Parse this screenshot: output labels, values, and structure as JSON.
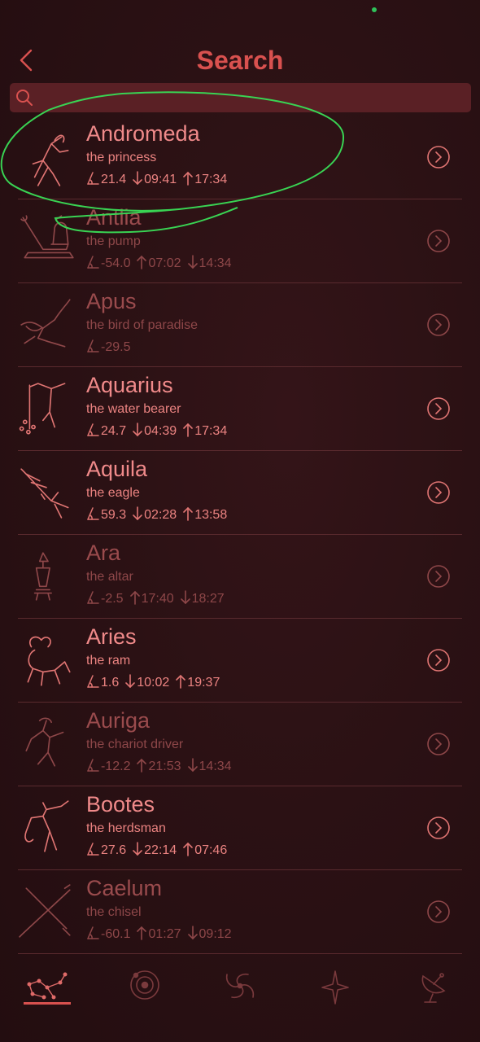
{
  "header": {
    "title": "Search"
  },
  "search": {
    "placeholder": "",
    "value": ""
  },
  "constellations": [
    {
      "name": "Andromeda",
      "subtitle": "the princess",
      "altitude": "21.4",
      "time1": "09:41",
      "dir1": "down",
      "time2": "17:34",
      "dir2": "up",
      "visible": true,
      "icon": "andromeda-figure-icon"
    },
    {
      "name": "Antlia",
      "subtitle": "the pump",
      "altitude": "-54.0",
      "time1": "07:02",
      "dir1": "up",
      "time2": "14:34",
      "dir2": "down",
      "visible": false,
      "icon": "antlia-pump-icon"
    },
    {
      "name": "Apus",
      "subtitle": "the bird of paradise",
      "altitude": "-29.5",
      "time1": "",
      "dir1": "",
      "time2": "",
      "dir2": "",
      "visible": false,
      "icon": "apus-bird-icon"
    },
    {
      "name": "Aquarius",
      "subtitle": "the water bearer",
      "altitude": "24.7",
      "time1": "04:39",
      "dir1": "down",
      "time2": "17:34",
      "dir2": "up",
      "visible": true,
      "icon": "aquarius-water-bearer-icon"
    },
    {
      "name": "Aquila",
      "subtitle": "the eagle",
      "altitude": "59.3",
      "time1": "02:28",
      "dir1": "down",
      "time2": "13:58",
      "dir2": "up",
      "visible": true,
      "icon": "aquila-eagle-icon"
    },
    {
      "name": "Ara",
      "subtitle": "the altar",
      "altitude": "-2.5",
      "time1": "17:40",
      "dir1": "up",
      "time2": "18:27",
      "dir2": "down",
      "visible": false,
      "icon": "ara-altar-icon"
    },
    {
      "name": "Aries",
      "subtitle": "the ram",
      "altitude": "1.6",
      "time1": "10:02",
      "dir1": "down",
      "time2": "19:37",
      "dir2": "up",
      "visible": true,
      "icon": "aries-ram-icon"
    },
    {
      "name": "Auriga",
      "subtitle": "the chariot driver",
      "altitude": "-12.2",
      "time1": "21:53",
      "dir1": "up",
      "time2": "14:34",
      "dir2": "down",
      "visible": false,
      "icon": "auriga-charioteer-icon"
    },
    {
      "name": "Bootes",
      "subtitle": "the herdsman",
      "altitude": "27.6",
      "time1": "22:14",
      "dir1": "down",
      "time2": "07:46",
      "dir2": "up",
      "visible": true,
      "icon": "bootes-herdsman-icon"
    },
    {
      "name": "Caelum",
      "subtitle": "the chisel",
      "altitude": "-60.1",
      "time1": "01:27",
      "dir1": "up",
      "time2": "09:12",
      "dir2": "down",
      "visible": false,
      "icon": "caelum-chisel-icon"
    }
  ],
  "bottom_nav": {
    "items": [
      {
        "icon": "constellation-icon",
        "active": true
      },
      {
        "icon": "planet-orbit-icon",
        "active": false
      },
      {
        "icon": "galaxy-icon",
        "active": false
      },
      {
        "icon": "star-icon",
        "active": false
      },
      {
        "icon": "satellite-dish-icon",
        "active": false
      }
    ]
  },
  "colors": {
    "background": "#2a1013",
    "accent": "#d9514f",
    "text_visible": "#f08a8a",
    "text_hidden": "#9a4b4d",
    "search_bg": "#5a2025",
    "annotation": "#39d353"
  }
}
